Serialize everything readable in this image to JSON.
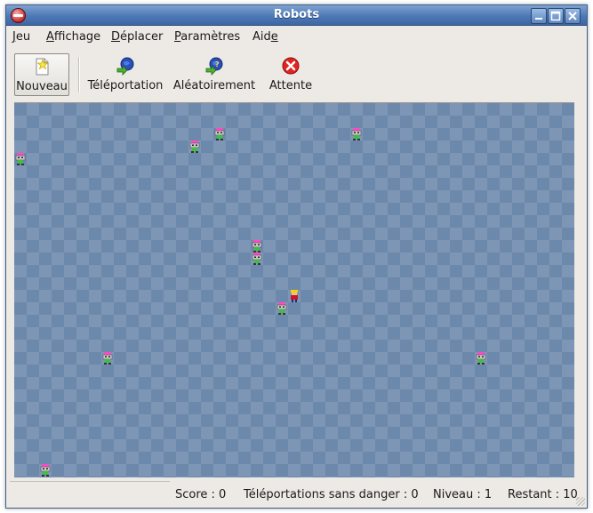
{
  "window": {
    "title": "Robots"
  },
  "menubar": {
    "items": [
      {
        "prefix": "",
        "mnemonic": "J",
        "rest": "eu"
      },
      {
        "prefix": "",
        "mnemonic": "A",
        "rest": "ffichage"
      },
      {
        "prefix": "",
        "mnemonic": "D",
        "rest": "éplacer"
      },
      {
        "prefix": "",
        "mnemonic": "P",
        "rest": "aramètres"
      },
      {
        "prefix": "Aid",
        "mnemonic": "e",
        "rest": ""
      }
    ]
  },
  "toolbar": {
    "buttons": [
      {
        "label": "Nouveau",
        "icon": "new-game-icon"
      },
      {
        "label": "Téléportation",
        "icon": "teleport-icon"
      },
      {
        "label": "Aléatoirement",
        "icon": "random-teleport-icon"
      },
      {
        "label": "Attente",
        "icon": "wait-icon"
      }
    ]
  },
  "board": {
    "columns": 45,
    "rows": 30,
    "player": {
      "col": 22,
      "row": 15
    },
    "robots": [
      {
        "col": 16,
        "row": 2
      },
      {
        "col": 27,
        "row": 2
      },
      {
        "col": 14,
        "row": 3
      },
      {
        "col": 0,
        "row": 4
      },
      {
        "col": 19,
        "row": 11
      },
      {
        "col": 19,
        "row": 12
      },
      {
        "col": 21,
        "row": 16
      },
      {
        "col": 7,
        "row": 20
      },
      {
        "col": 37,
        "row": 20
      },
      {
        "col": 2,
        "row": 29
      }
    ],
    "colors": {
      "light": "#7d96b6",
      "dark": "#6c89ab"
    }
  },
  "statusbar": {
    "score": "Score : 0",
    "safe_teleports": "Téléportations sans danger : 0",
    "level": "Niveau : 1",
    "remaining": "Restant : 10"
  }
}
